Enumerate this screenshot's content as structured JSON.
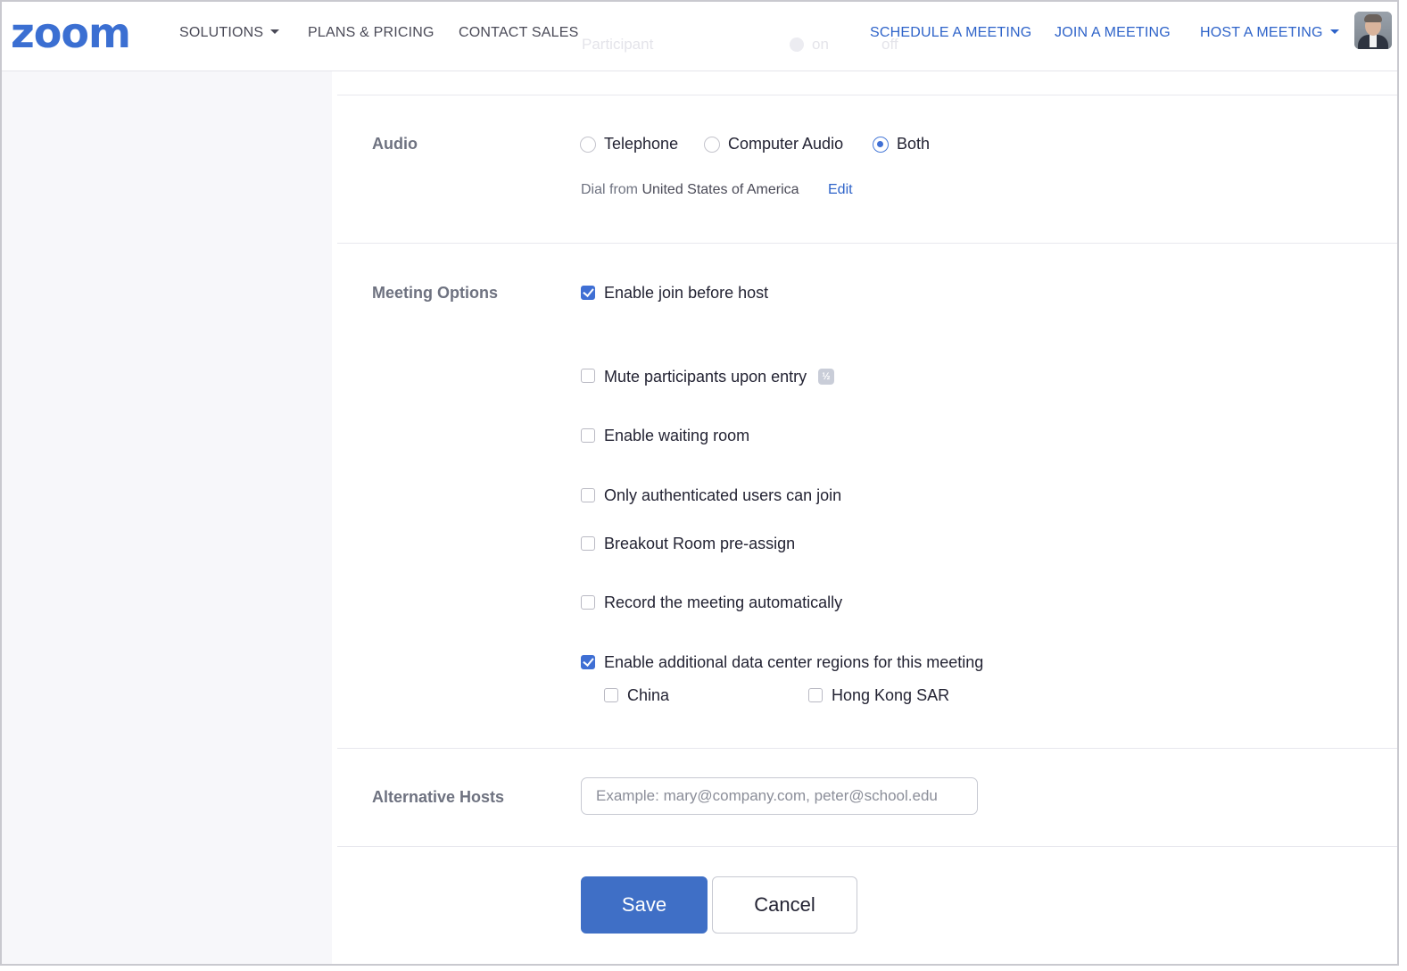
{
  "header": {
    "logo_text": "zoom",
    "nav_left": [
      {
        "label": "SOLUTIONS",
        "has_caret": true
      },
      {
        "label": "PLANS & PRICING"
      },
      {
        "label": "CONTACT SALES"
      }
    ],
    "nav_right": [
      {
        "label": "SCHEDULE A MEETING"
      },
      {
        "label": "JOIN A MEETING"
      },
      {
        "label": "HOST A MEETING",
        "has_caret": true
      }
    ],
    "behind_text": {
      "participant": "Participant",
      "on": "on",
      "off": "off"
    }
  },
  "audio": {
    "label": "Audio",
    "options": [
      {
        "label": "Telephone",
        "selected": false
      },
      {
        "label": "Computer Audio",
        "selected": false
      },
      {
        "label": "Both",
        "selected": true
      }
    ],
    "dial_prefix": "Dial from",
    "dial_country": "United States of America",
    "edit_label": "Edit"
  },
  "meeting_options": {
    "label": "Meeting Options",
    "items": [
      {
        "label": "Enable join before host",
        "checked": true
      },
      {
        "label": "Mute participants upon entry",
        "checked": false,
        "badge": "½"
      },
      {
        "label": "Enable waiting room",
        "checked": false
      },
      {
        "label": "Only authenticated users can join",
        "checked": false
      },
      {
        "label": "Breakout Room pre-assign",
        "checked": false
      },
      {
        "label": "Record the meeting automatically",
        "checked": false
      },
      {
        "label": "Enable additional data center regions for this meeting",
        "checked": true
      }
    ],
    "regions": [
      {
        "label": "China",
        "checked": false
      },
      {
        "label": "Hong Kong SAR",
        "checked": false
      }
    ]
  },
  "alternative_hosts": {
    "label": "Alternative Hosts",
    "value": "",
    "placeholder": "Example: mary@company.com, peter@school.edu"
  },
  "actions": {
    "save_label": "Save",
    "cancel_label": "Cancel"
  },
  "colors": {
    "brand_blue": "#3b6fd2",
    "save_button": "#3f6fc6",
    "link_blue": "#2e63c9"
  }
}
